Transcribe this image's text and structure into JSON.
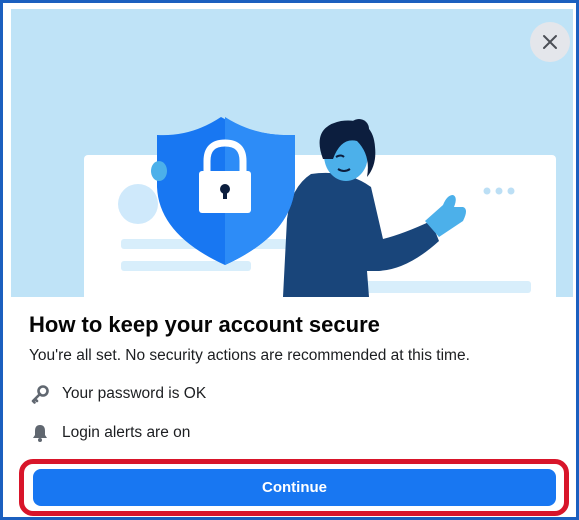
{
  "dialog": {
    "title": "How to keep your account secure",
    "subtitle": "You're all set. No security actions are recommended at this time.",
    "items": [
      {
        "icon": "key-icon",
        "label": "Your password is OK"
      },
      {
        "icon": "bell-icon",
        "label": "Login alerts are on"
      }
    ],
    "continue_label": "Continue",
    "close_icon": "close-icon"
  },
  "colors": {
    "accent": "#1877f2",
    "highlight": "#d8152a",
    "hero_background": "#bfe3f7",
    "frame_border": "#1b5fbf"
  }
}
